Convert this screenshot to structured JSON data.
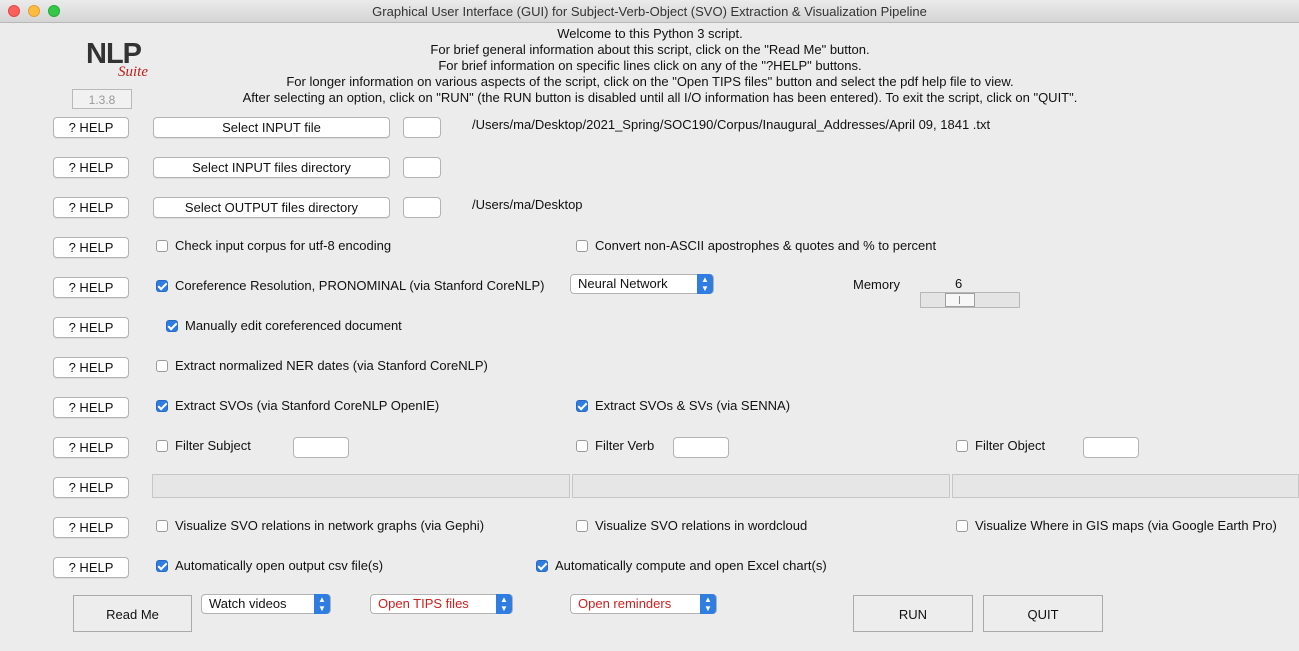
{
  "window": {
    "title": "Graphical User Interface (GUI) for Subject-Verb-Object (SVO) Extraction & Visualization Pipeline"
  },
  "welcome": [
    "Welcome to this Python 3 script.",
    "For brief general information about this script, click on the \"Read Me\" button.",
    "For brief information on specific lines click on any of the \"?HELP\" buttons.",
    "For longer information on various aspects of the script, click on the \"Open TIPS files\" button and select the pdf help file to view.",
    "After selecting an option, click on \"RUN\" (the RUN button is disabled until all I/O information has been entered).   To exit the script, click on \"QUIT\"."
  ],
  "logo": {
    "nlp": "NLP",
    "suite": "Suite"
  },
  "version": "1.3.8",
  "help_label": "? HELP",
  "io": {
    "input_file_btn": "Select INPUT file",
    "input_file_path": "/Users/ma/Desktop/2021_Spring/SOC190/Corpus/Inaugural_Addresses/April 09, 1841 .txt",
    "input_dir_btn": "Select INPUT files directory",
    "output_dir_btn": "Select OUTPUT files directory",
    "output_dir_path": "/Users/ma/Desktop"
  },
  "options": {
    "utf8": {
      "label": "Check input corpus for utf-8 encoding",
      "checked": false
    },
    "convert": {
      "label": "Convert non-ASCII apostrophes & quotes and % to percent",
      "checked": false
    },
    "coref": {
      "label": "Coreference Resolution, PRONOMINAL (via Stanford CoreNLP)",
      "checked": true
    },
    "coref_method": "Neural Network",
    "memory_label": "Memory",
    "memory_value": "6",
    "manual_edit": {
      "label": "Manually edit coreferenced document",
      "checked": true
    },
    "ner_dates": {
      "label": "Extract normalized NER dates (via Stanford CoreNLP)",
      "checked": false
    },
    "svo_openie": {
      "label": "Extract SVOs (via Stanford CoreNLP OpenIE)",
      "checked": true
    },
    "svo_senna": {
      "label": "Extract SVOs & SVs (via SENNA)",
      "checked": true
    },
    "filter_subject": {
      "label": "Filter Subject",
      "checked": false
    },
    "filter_verb": {
      "label": "Filter Verb",
      "checked": false
    },
    "filter_object": {
      "label": "Filter Object",
      "checked": false
    },
    "gephi": {
      "label": "Visualize SVO relations in network graphs (via Gephi)",
      "checked": false
    },
    "wordcloud": {
      "label": "Visualize SVO relations in wordcloud",
      "checked": false
    },
    "gis": {
      "label": "Visualize Where in GIS maps (via Google Earth Pro)",
      "checked": false
    },
    "open_csv": {
      "label": "Automatically open output csv file(s)",
      "checked": true
    },
    "excel_chart": {
      "label": "Automatically compute and open Excel chart(s)",
      "checked": true
    }
  },
  "bottom": {
    "read_me": "Read Me",
    "watch_videos": "Watch videos",
    "open_tips": "Open TIPS files",
    "open_reminders": "Open reminders",
    "run": "RUN",
    "quit": "QUIT"
  },
  "colors": {
    "accent": "#2f7de1",
    "red_text": "#d01e1e",
    "background": "#ececec"
  }
}
